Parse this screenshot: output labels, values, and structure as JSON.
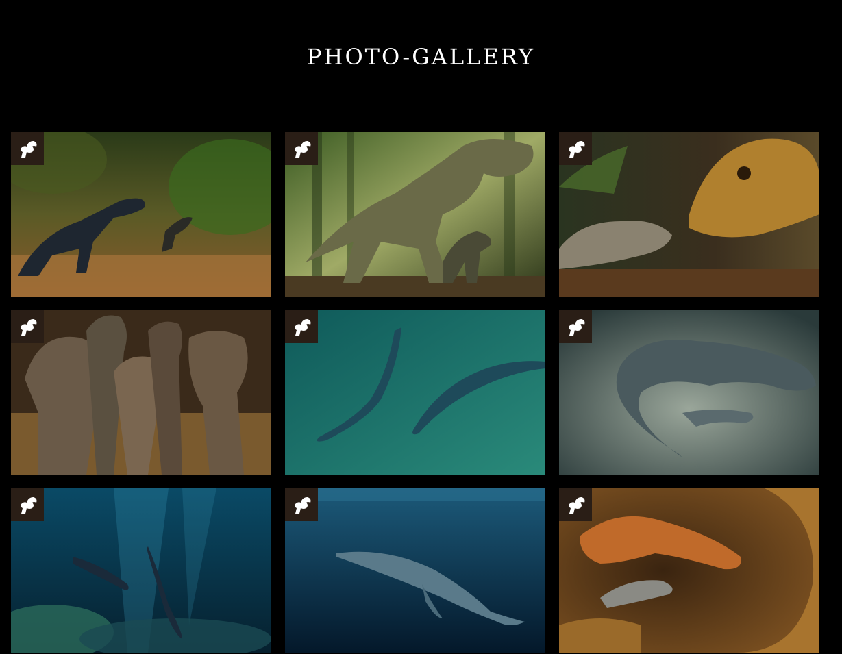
{
  "page": {
    "title": "PHOTO-GALLERY"
  },
  "badge_icon": "dinosaur-logo-icon",
  "gallery": {
    "tiles": [
      {
        "scene": "jungle-raptors",
        "palette": [
          "#3e3a1c",
          "#8a6a3a",
          "#1c2a14"
        ]
      },
      {
        "scene": "trex-forest",
        "palette": [
          "#2f4a22",
          "#9aa86a",
          "#1a2412"
        ]
      },
      {
        "scene": "dino-close-up",
        "palette": [
          "#2a2418",
          "#b08038",
          "#46402c"
        ]
      },
      {
        "scene": "raptor-group",
        "palette": [
          "#3a2c1c",
          "#8a7a5a",
          "#1e1810"
        ]
      },
      {
        "scene": "swimming-reptiles",
        "palette": [
          "#0f5a5a",
          "#2a8a86",
          "#0a3a3e"
        ]
      },
      {
        "scene": "plesiosaur-murky",
        "palette": [
          "#3a4a48",
          "#9aa6a0",
          "#1e2a28"
        ]
      },
      {
        "scene": "underwater-reef",
        "palette": [
          "#0a3a50",
          "#1e7a9a",
          "#061e2a"
        ]
      },
      {
        "scene": "ichthyosaur-deep",
        "palette": [
          "#0a3048",
          "#1c5a7a",
          "#04182a"
        ]
      },
      {
        "scene": "pterosaur-nest",
        "palette": [
          "#5a3a1a",
          "#c0803a",
          "#2a1a0c"
        ]
      }
    ]
  }
}
